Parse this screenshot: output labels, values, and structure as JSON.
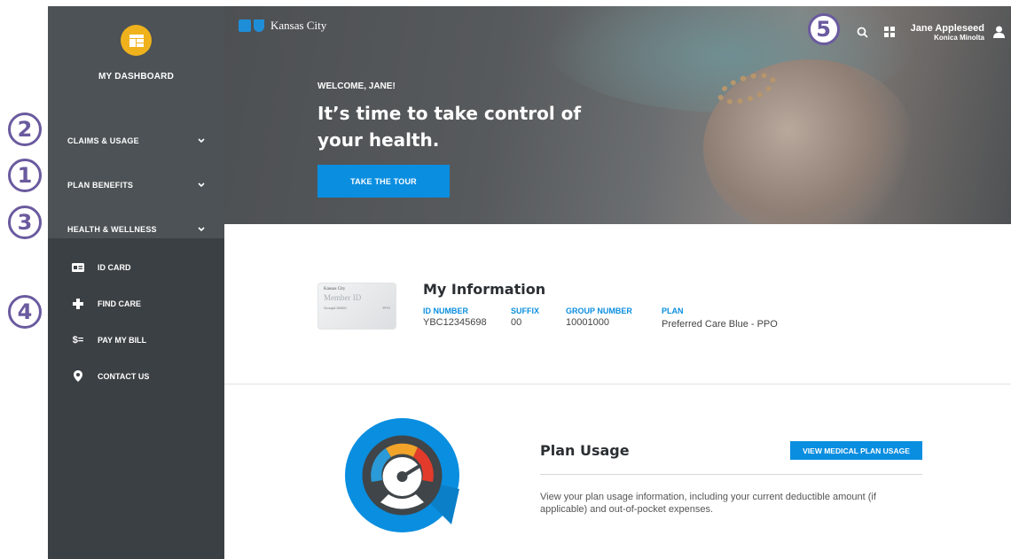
{
  "annotations": [
    "2",
    "1",
    "3",
    "4",
    "5"
  ],
  "sidebar": {
    "dashboard_label": "MY DASHBOARD",
    "menu": [
      {
        "label": "CLAIMS & USAGE",
        "icon": "chevron-down-icon"
      },
      {
        "label": "PLAN BENEFITS",
        "icon": "chevron-down-icon"
      },
      {
        "label": "HEALTH & WELLNESS",
        "icon": "chevron-down-icon"
      }
    ],
    "links": [
      {
        "label": "ID CARD",
        "icon": "id-card-icon"
      },
      {
        "label": "FIND CARE",
        "icon": "plus-icon"
      },
      {
        "label": "PAY MY BILL",
        "icon": "dollar-icon"
      },
      {
        "label": "CONTACT US",
        "icon": "location-pin-icon"
      }
    ]
  },
  "header": {
    "brand": "Kansas City",
    "user_name": "Jane Appleseed",
    "user_org": "Konica Minolta"
  },
  "hero": {
    "welcome": "WELCOME, JANE!",
    "headline": "It’s time to take control of your health.",
    "tour_button": "TAKE THE TOUR"
  },
  "my_info": {
    "title": "My Information",
    "card": {
      "brand": "Kansas City",
      "member_id": "Member ID",
      "group": "Group# 00000",
      "plan": "PPO"
    },
    "fields": [
      {
        "label": "ID NUMBER",
        "value": "YBC12345698"
      },
      {
        "label": "SUFFIX",
        "value": "00"
      },
      {
        "label": "GROUP NUMBER",
        "value": "10001000"
      },
      {
        "label": "PLAN",
        "value": "Preferred Care Blue - PPO"
      }
    ]
  },
  "plan_usage": {
    "title": "Plan Usage",
    "button": "VIEW MEDICAL PLAN USAGE",
    "description": "View your plan usage information, including your current deductible amount (if applicable) and out-of-pocket expenses."
  },
  "colors": {
    "accent": "#0a8ee0",
    "sidebar": "#3b4044",
    "dashboard_icon": "#efb21c",
    "annotation": "#6a5a9e"
  }
}
